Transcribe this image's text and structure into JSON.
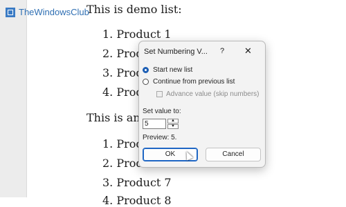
{
  "watermark": {
    "text": "TheWindowsClub"
  },
  "document": {
    "heading1": "This is demo list:",
    "heading2": "This is and",
    "list1": [
      "1. Product 1",
      "2. Prod",
      "3. Prod",
      "4. Prod"
    ],
    "list2": [
      "1. Prod",
      "2. Prod",
      "3. Product 7",
      "4. Product 8"
    ]
  },
  "dialog": {
    "title": "Set Numbering V...",
    "help": "?",
    "close": "✕",
    "option_start_new": "Start new list",
    "option_continue": "Continue from previous list",
    "option_advance": "Advance value (skip numbers)",
    "set_value_label": "Set value to:",
    "set_value": "5",
    "preview": "Preview: 5.",
    "ok_label": "OK",
    "cancel_label": "Cancel"
  },
  "colors": {
    "accent": "#1e66c4",
    "watermark": "#2f6fb3"
  }
}
